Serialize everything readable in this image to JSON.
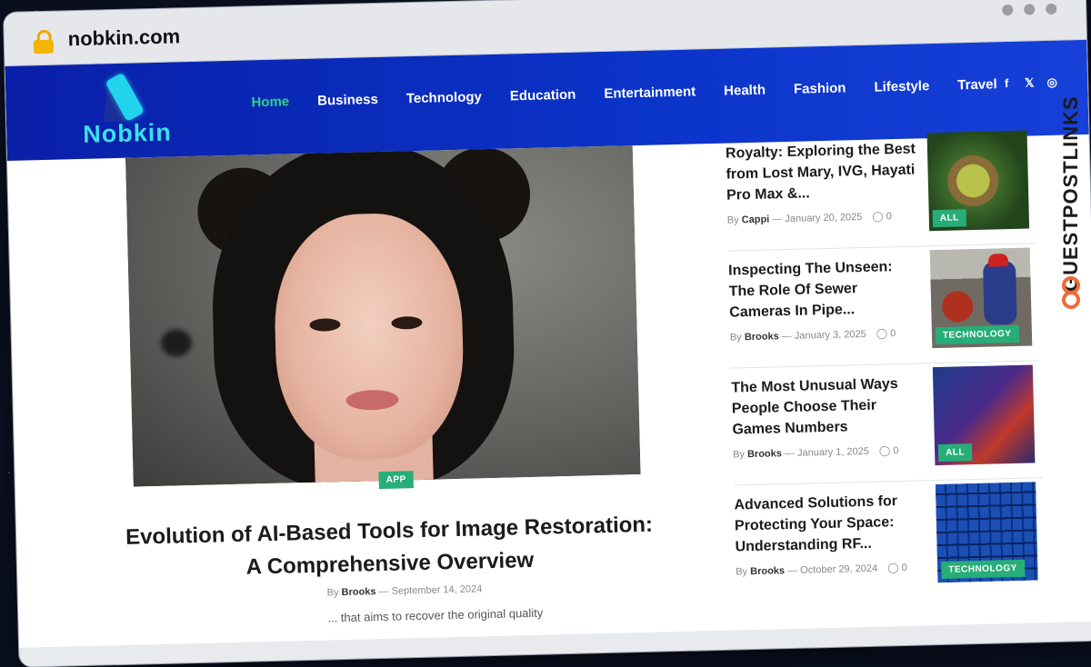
{
  "browser": {
    "url": "nobkin.com"
  },
  "site": {
    "logo_text": "Nobkin",
    "nav": [
      {
        "label": "Home",
        "active": true
      },
      {
        "label": "Business"
      },
      {
        "label": "Technology"
      },
      {
        "label": "Education"
      },
      {
        "label": "Entertainment"
      },
      {
        "label": "Health"
      },
      {
        "label": "Fashion"
      },
      {
        "label": "Lifestyle"
      },
      {
        "label": "Travel"
      }
    ],
    "social": {
      "facebook": "f",
      "x": "𝕏",
      "instagram": "◎"
    },
    "colors": {
      "header": "#0b34c9",
      "accent": "#2fcf88",
      "tag": "#27ae78"
    }
  },
  "hero": {
    "tag": "APP",
    "title": "Evolution of AI-Based Tools for Image Restoration: A Comprehensive Overview",
    "by": "By",
    "author": "Brooks",
    "sep": "—",
    "date": "September 14, 2024",
    "excerpt": "... that aims to recover the original quality"
  },
  "sidebar": [
    {
      "title": "Royalty: Exploring the Best from Lost Mary, IVG, Hayati Pro Max &...",
      "by": "By",
      "author": "Cappi",
      "sep": "—",
      "date": "January 20, 2025",
      "comments": "0",
      "tag": "ALL"
    },
    {
      "title": "Inspecting The Unseen: The Role Of Sewer Cameras In Pipe...",
      "by": "By",
      "author": "Brooks",
      "sep": "—",
      "date": "January 3, 2025",
      "comments": "0",
      "tag": "TECHNOLOGY"
    },
    {
      "title": "The Most Unusual Ways People Choose Their Games Numbers",
      "by": "By",
      "author": "Brooks",
      "sep": "—",
      "date": "January 1, 2025",
      "comments": "0",
      "tag": "ALL"
    },
    {
      "title": "Advanced Solutions for Protecting Your Space: Understanding RF...",
      "by": "By",
      "author": "Brooks",
      "sep": "—",
      "date": "October 29, 2024",
      "comments": "0",
      "tag": "TECHNOLOGY"
    }
  ],
  "watermark": {
    "text": "GUESTPOSTLINKS"
  },
  "icons": {
    "comment": "comment-icon",
    "lock": "lock-icon"
  }
}
